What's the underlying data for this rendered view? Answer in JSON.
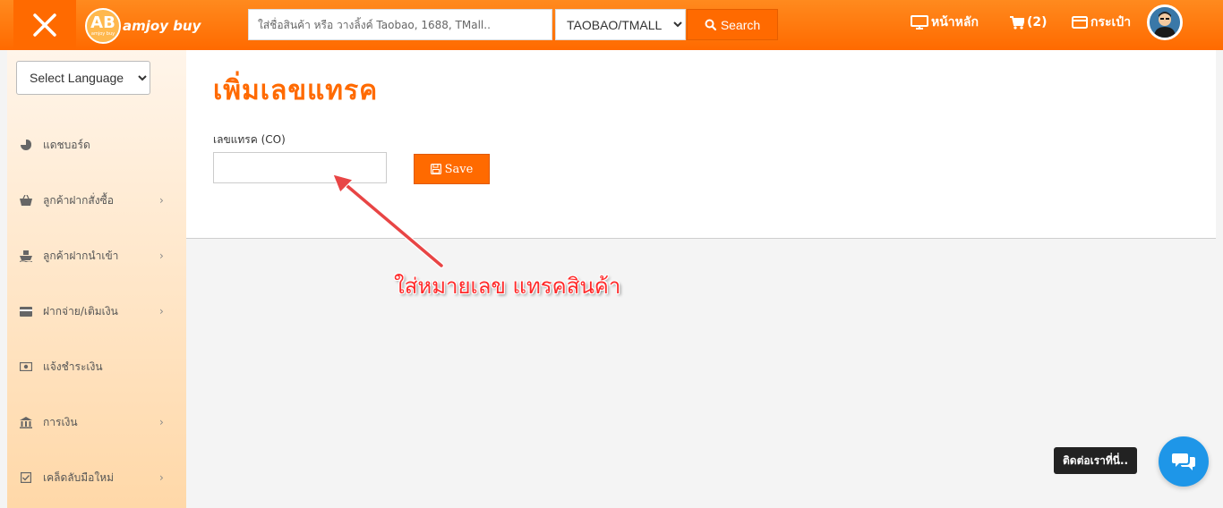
{
  "header": {
    "logo_letters": "AB",
    "logo_small": "amjoy buy",
    "logo_text": "amjoy buy",
    "search_placeholder": "ใส่ชื่อสินค้า หรือ วางลิ้งค์ Taobao, 1688, TMall..",
    "platform_selected": "TAOBAO/TMALL",
    "search_label": "Search",
    "home_label": "หน้าหลัก",
    "cart_label": "(2)",
    "wallet_label": "กระเป๋า",
    "accent_color": "#ff6a00"
  },
  "sidebar": {
    "language_selected": "Select Language",
    "items": [
      {
        "label": "แดชบอร์ด",
        "icon": "pie-chart-icon",
        "has_submenu": false
      },
      {
        "label": "ลูกค้าฝากสั่งซื้อ",
        "icon": "basket-icon",
        "has_submenu": true
      },
      {
        "label": "ลูกค้าฝากนำเข้า",
        "icon": "ship-icon",
        "has_submenu": true
      },
      {
        "label": "ฝากจ่าย/เติมเงิน",
        "icon": "credit-card-icon",
        "has_submenu": true
      },
      {
        "label": "แจ้งชำระเงิน",
        "icon": "money-icon",
        "has_submenu": false
      },
      {
        "label": "การเงิน",
        "icon": "bank-icon",
        "has_submenu": true
      },
      {
        "label": "เคล็ดลับมือใหม่",
        "icon": "checkbox-icon",
        "has_submenu": true
      }
    ],
    "chevron": "›"
  },
  "main": {
    "title": "เพิ่มเลขแทรค",
    "field_label": "เลขแทรค (CO)",
    "field_value": "",
    "save_label": "Save"
  },
  "annotation": {
    "text": "ใส่หมายเลข แทรคสินค้า",
    "color": "#ff2a2a"
  },
  "chat": {
    "label": "ติดต่อเราที่นี่..",
    "color": "#1e96e8"
  }
}
